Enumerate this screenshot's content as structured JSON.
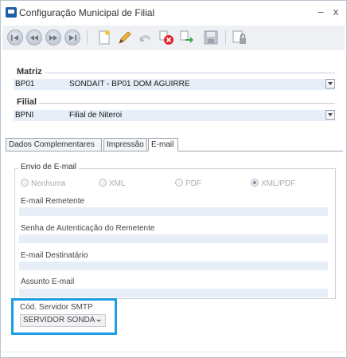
{
  "window": {
    "title": "Configuração Municipal de Filial",
    "minimize": "–",
    "close": "x"
  },
  "toolbar": {
    "buttons": [
      "first",
      "previous",
      "next",
      "last",
      "new",
      "edit",
      "undo",
      "delete",
      "confirm",
      "save",
      "lock"
    ]
  },
  "matriz": {
    "label": "Matriz",
    "code": "BP01",
    "description": "SONDAIT - BP01 DOM AGUIRRE"
  },
  "filial": {
    "label": "Filial",
    "code": "BPNI",
    "description": "Filial de Niteroi"
  },
  "tabs": [
    {
      "label": "Dados Complementares",
      "active": false
    },
    {
      "label": "Impressão",
      "active": false
    },
    {
      "label": "E-mail",
      "active": true
    }
  ],
  "email": {
    "group_title": "Envio de E-mail",
    "formats": [
      {
        "label": "Nenhuma",
        "checked": false
      },
      {
        "label": "XML",
        "checked": false
      },
      {
        "label": "PDF",
        "checked": false
      },
      {
        "label": "XML/PDF",
        "checked": true
      }
    ],
    "fields": [
      {
        "label": "E-mail Remetente",
        "value": ""
      },
      {
        "label": "Senha de Autenticação do Remetente",
        "value": ""
      },
      {
        "label": "E-mail Destinatário",
        "value": ""
      },
      {
        "label": "Assunto E-mail",
        "value": ""
      }
    ],
    "smtp_label": "Cód. Servidor SMTP",
    "smtp_value": "SERVIDOR SONDA"
  },
  "colors": {
    "highlight": "#1b9ee3",
    "input_bg": "#e7eef8",
    "brand": "#1b5fa8"
  }
}
